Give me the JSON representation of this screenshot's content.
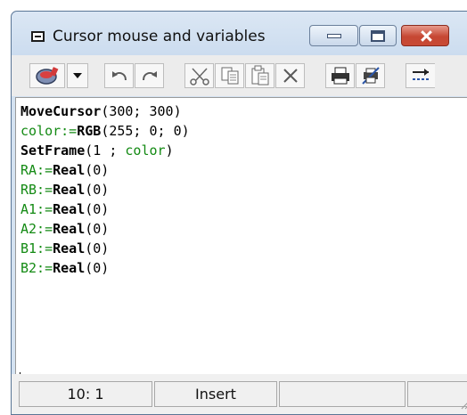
{
  "window": {
    "title": "Cursor mouse and variables"
  },
  "title_buttons": [
    "minimize",
    "maximize",
    "close"
  ],
  "toolbar": {
    "buttons": [
      "run-icon",
      "dropdown-arrow-icon",
      "undo-icon",
      "redo-icon",
      "cut-icon",
      "copy-icon",
      "paste-icon",
      "delete-icon",
      "print-icon",
      "print-setup-icon",
      "more-icon"
    ]
  },
  "editor": {
    "lines": [
      [
        "MoveCursor",
        "(300; 300)"
      ],
      [
        "color:=",
        "RGB",
        "(255; 0; 0)"
      ],
      [
        "SetFrame",
        "(1 ; ",
        "color",
        ")"
      ],
      [
        "RA:=",
        "Real",
        "(0)"
      ],
      [
        "RB:=",
        "Real",
        "(0)"
      ],
      [
        "A1:=",
        "Real",
        "(0)"
      ],
      [
        "A2:=",
        "Real",
        "(0)"
      ],
      [
        "B1:=",
        "Real",
        "(0)"
      ],
      [
        "B2:=",
        "Real",
        "(0)"
      ]
    ]
  },
  "statusbar": {
    "position": "10: 1",
    "mode": "Insert"
  },
  "colors": {
    "keyword": "#000000",
    "variable": "#138a13",
    "close_button": "#c64733"
  }
}
